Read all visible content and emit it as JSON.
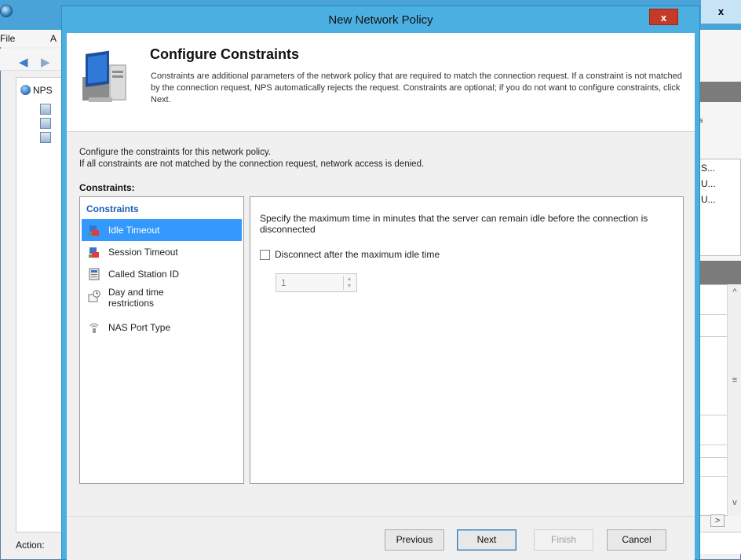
{
  "background_window": {
    "menu": [
      "File",
      "A"
    ],
    "tree_root_label": "NPS",
    "status_label": "Action:",
    "right_panel_text": "es",
    "right_panel_cells": [
      "S...",
      "U...",
      "U..."
    ],
    "close_glyph": "x",
    "scroll_glyphs": {
      "up": "^",
      "mid": "≡",
      "down": "v",
      "right": ">"
    }
  },
  "dialog": {
    "title": "New Network Policy",
    "close_glyph": "x",
    "header": {
      "title": "Configure Constraints",
      "description": "Constraints are additional parameters of the network policy that are required to match the connection request. If a constraint is not matched by the connection request, NPS automatically rejects the request. Constraints are optional; if you do not want to configure constraints, click Next."
    },
    "instructions": [
      "Configure the constraints for this network policy.",
      "If all constraints are not matched by the connection request, network access is denied."
    ],
    "constraints_label": "Constraints:",
    "constraints_list": {
      "header": "Constraints",
      "items": [
        {
          "label": "Idle Timeout",
          "icon": "idle-timeout-icon",
          "selected": true
        },
        {
          "label": "Session Timeout",
          "icon": "session-timeout-icon",
          "selected": false
        },
        {
          "label": "Called Station ID",
          "icon": "called-station-icon",
          "selected": false
        },
        {
          "label": "Day and time restrictions",
          "icon": "clock-calendar-icon",
          "selected": false
        },
        {
          "label": "NAS Port Type",
          "icon": "nas-port-icon",
          "selected": false
        }
      ]
    },
    "panel": {
      "description": "Specify the maximum time in minutes that the server can remain idle before the connection is disconnected",
      "checkbox_label": "Disconnect after the maximum idle time",
      "checkbox_checked": false,
      "spinner_value": "1"
    },
    "buttons": {
      "previous": "Previous",
      "next": "Next",
      "finish": "Finish",
      "cancel": "Cancel"
    }
  }
}
